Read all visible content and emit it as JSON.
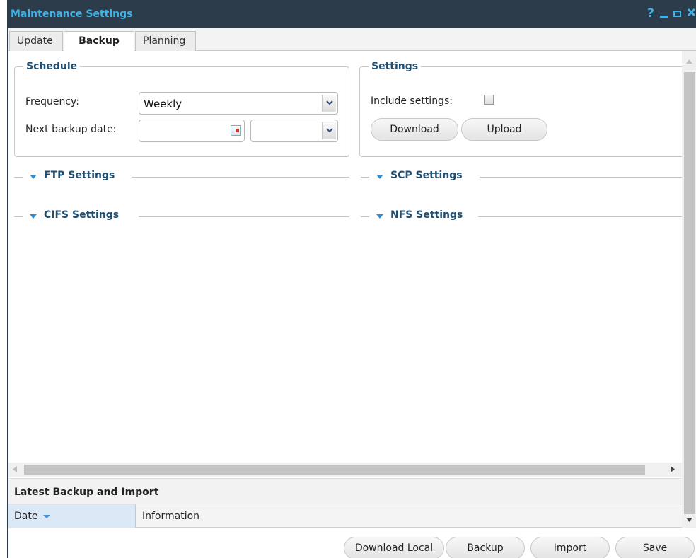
{
  "window": {
    "title": "Maintenance Settings",
    "help_symbol": "?"
  },
  "tabs": [
    {
      "label": "Update",
      "active": false
    },
    {
      "label": "Backup",
      "active": true
    },
    {
      "label": "Planning",
      "active": false
    }
  ],
  "schedule": {
    "legend": "Schedule",
    "frequency_label": "Frequency:",
    "frequency_value": "Weekly",
    "next_backup_label": "Next backup date:",
    "next_backup_date": "",
    "next_backup_time": ""
  },
  "settings": {
    "legend": "Settings",
    "include_label": "Include settings:",
    "include_checked": false,
    "download_label": "Download",
    "upload_label": "Upload"
  },
  "sections": {
    "ftp": "FTP Settings",
    "scp": "SCP Settings",
    "cifs": "CIFS Settings",
    "nfs": "NFS Settings"
  },
  "latest": {
    "title": "Latest Backup and Import",
    "col_date": "Date",
    "col_info": "Information"
  },
  "footer": {
    "download_local": "Download Local",
    "backup": "Backup",
    "import": "Import",
    "save": "Save"
  },
  "colors": {
    "titlebar_bg": "#2d3c4b",
    "title_text": "#3fb3e8",
    "legend_text": "#1f4f72",
    "sort_arrow": "#4a90d9"
  }
}
